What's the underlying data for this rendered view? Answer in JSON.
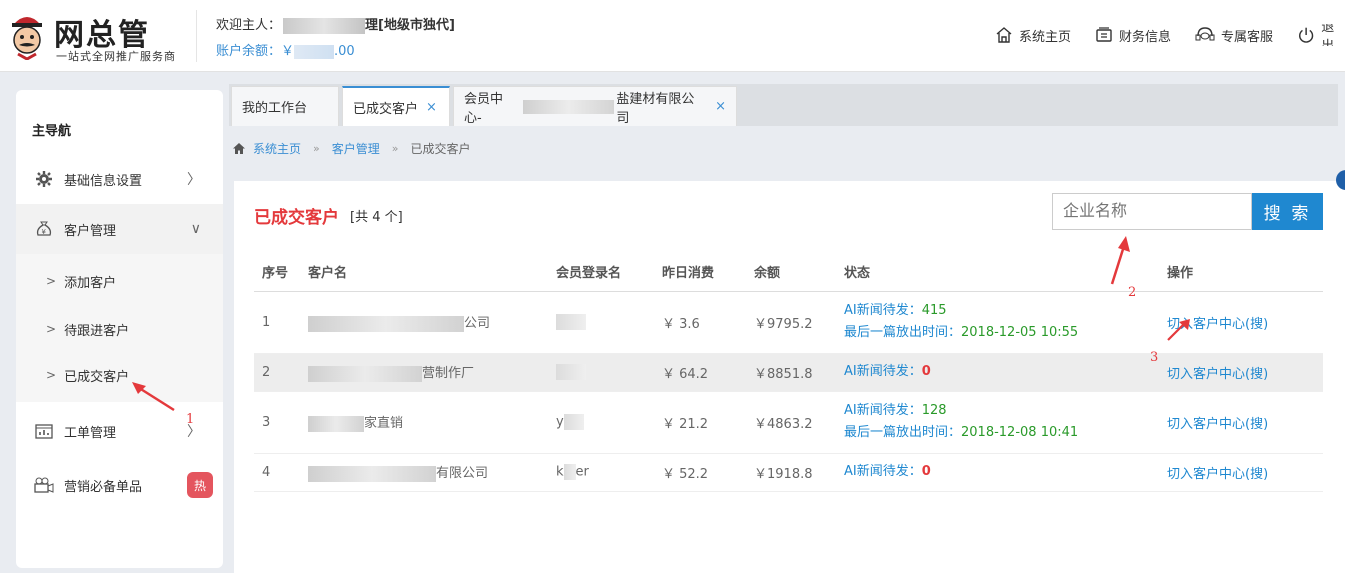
{
  "header": {
    "brand_title": "网总管",
    "brand_sub": "一站式全网推广服务商",
    "welcome_prefix": "欢迎主人：",
    "welcome_suffix": "[地级市独代]",
    "welcome_tail": "理",
    "balance_prefix": "账户余额：￥",
    "balance_suffix": ".00",
    "nav": [
      {
        "label": "系统主页",
        "icon": "home-icon"
      },
      {
        "label": "财务信息",
        "icon": "wallet-icon"
      },
      {
        "label": "专属客服",
        "icon": "headset-icon"
      },
      {
        "label": "退出",
        "icon": "power-icon"
      }
    ]
  },
  "sidebar": {
    "title": "主导航",
    "items": [
      {
        "label": "基础信息设置",
        "icon": "gear-icon"
      },
      {
        "label": "客户管理",
        "icon": "money-bag-icon"
      },
      {
        "label": "工单管理",
        "icon": "calendar-chart-icon"
      },
      {
        "label": "营销必备单品",
        "icon": "camera-icon",
        "badge": "热"
      }
    ],
    "sub_items": [
      {
        "label": "添加客户"
      },
      {
        "label": "待跟进客户"
      },
      {
        "label": "已成交客户"
      }
    ]
  },
  "tabs": [
    {
      "label": "我的工作台"
    },
    {
      "label": "已成交客户",
      "close": "×"
    },
    {
      "label_prefix": "会员中心-",
      "label_suffix": "盐建材有限公司",
      "close": "×"
    }
  ],
  "breadcrumb": {
    "items": [
      "系统主页",
      "客户管理",
      "已成交客户"
    ],
    "sep": "»"
  },
  "panel": {
    "title": "已成交客户",
    "count": "[共 4 个]",
    "search_placeholder": "企业名称",
    "search_button": "搜 索"
  },
  "table": {
    "headers": [
      "序号",
      "客户名",
      "会员登录名",
      "昨日消费",
      "余额",
      "状态",
      "操作"
    ],
    "rows": [
      {
        "idx": "1",
        "name_suffix": "公司",
        "login": "",
        "yesterday": "￥ 3.6",
        "balance": "￥9795.2",
        "status_label": "AI新闻待发：",
        "status_value": "415",
        "last_label": "最后一篇放出时间：",
        "last_time": "2018-12-05 10:55",
        "action": "切入客户中心(搜)"
      },
      {
        "idx": "2",
        "name_suffix": "营制作厂",
        "login": "",
        "yesterday": "￥ 64.2",
        "balance": "￥8851.8",
        "status_label": "AI新闻待发：",
        "status_value": "0",
        "action": "切入客户中心(搜)"
      },
      {
        "idx": "3",
        "name_suffix": "家直销",
        "login": "y",
        "yesterday": "￥ 21.2",
        "balance": "￥4863.2",
        "status_label": "AI新闻待发：",
        "status_value": "128",
        "last_label": "最后一篇放出时间：",
        "last_time": "2018-12-08 10:41",
        "action": "切入客户中心(搜)"
      },
      {
        "idx": "4",
        "name_suffix": "有限公司",
        "login": "k",
        "login_tail": "er",
        "yesterday": "￥ 52.2",
        "balance": "￥1918.8",
        "status_label": "AI新闻待发：",
        "status_value": "0",
        "action": "切入客户中心(搜)"
      }
    ]
  },
  "annotations": [
    "1",
    "2",
    "3"
  ],
  "colors": {
    "accent": "#1f88d0",
    "title_red": "#e4393c",
    "green": "#2a9a2a"
  }
}
